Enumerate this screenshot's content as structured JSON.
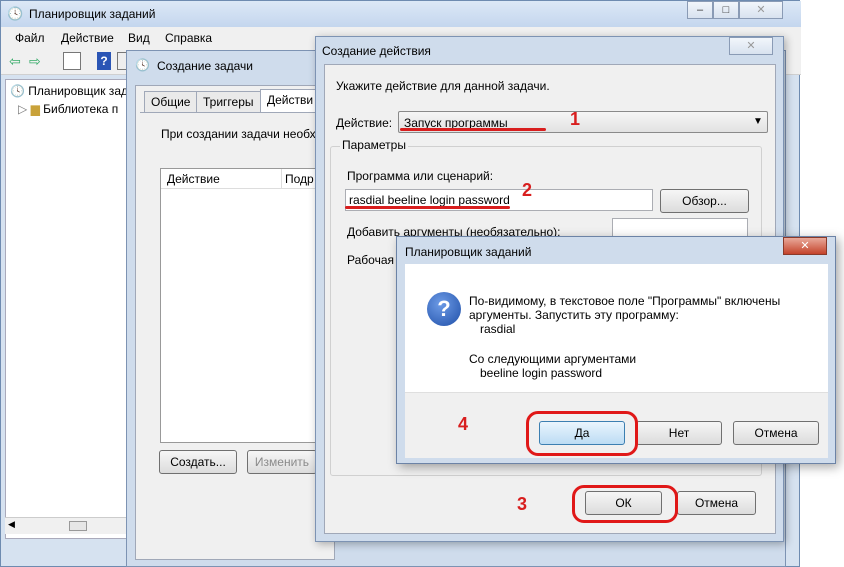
{
  "main_window": {
    "title": "Планировщик заданий",
    "menu": [
      "Файл",
      "Действие",
      "Вид",
      "Справка"
    ],
    "tree": [
      "Планировщик зада",
      "Библиотека п"
    ]
  },
  "task_window": {
    "title": "Создание задачи",
    "tabs": [
      "Общие",
      "Триггеры",
      "Действи"
    ],
    "hint": "При создании задачи необх",
    "columns": [
      "Действие",
      "Подр"
    ],
    "create_button": "Создать...",
    "edit_button": "Изменить"
  },
  "action_window": {
    "title": "Создание действия",
    "prompt": "Укажите действие для данной задачи.",
    "action_label": "Действие:",
    "action_value": "Запуск программы",
    "params_group": "Параметры",
    "program_label": "Программа или сценарий:",
    "program_value": "rasdial beeline login password",
    "browse_button": "Обзор...",
    "args_label": "Добавить аргументы (необязательно):",
    "workdir_label": "Рабочая",
    "ok_button": "ОК",
    "cancel_button": "Отмена"
  },
  "confirm_dialog": {
    "title": "Планировщик заданий",
    "message_line1": "По-видимому, в текстовое поле \"Программы\" включены",
    "message_line2": "аргументы. Запустить эту программу:",
    "program": "rasdial",
    "args_intro": "Со следующими аргументами",
    "args": "beeline login password",
    "yes_button": "Да",
    "no_button": "Нет",
    "cancel_button": "Отмена"
  },
  "annotations": {
    "n1": "1",
    "n2": "2",
    "n3": "3",
    "n4": "4"
  },
  "colors": {
    "annotation_red": "#d81e1e",
    "titlebar": "#cfdcec"
  }
}
